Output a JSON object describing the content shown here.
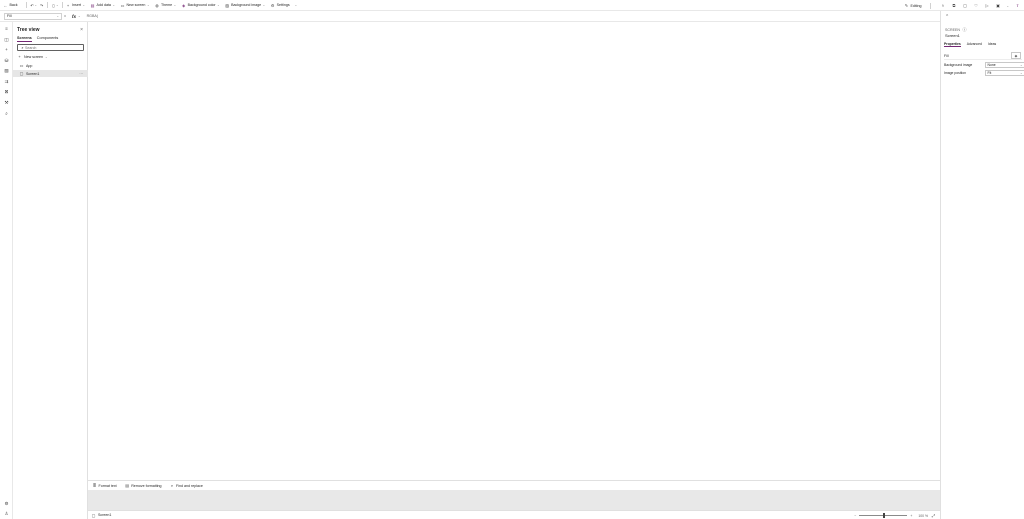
{
  "command_bar": {
    "back": "Back",
    "insert": "Insert",
    "add_data": "Add data",
    "new_screen": "New screen",
    "theme": "Theme",
    "background_color": "Background color",
    "background_image": "Background image",
    "settings": "Settings",
    "editing": "Editing"
  },
  "formula_bar": {
    "property": "Fill",
    "equals": "=",
    "fx": "fx",
    "value": "RGBA("
  },
  "tree_view": {
    "title": "Tree view",
    "tabs": [
      "Screens",
      "Components"
    ],
    "search_placeholder": "Search",
    "new_screen": "New screen",
    "items": [
      "App",
      "Screen1"
    ]
  },
  "bottom_toolbar": {
    "format_text": "Format text",
    "remove_formatting": "Remove formatting",
    "find_replace": "Find and replace"
  },
  "status_bar": {
    "screen": "Screen1",
    "zoom_minus": "−",
    "zoom_plus": "+",
    "zoom_value": "100 %",
    "zoom_level": 0.5
  },
  "properties_panel": {
    "kind": "SCREEN",
    "screen_name": "Screen1",
    "tabs": [
      "Properties",
      "Advanced",
      "Ideas"
    ],
    "fill_label": "Fill",
    "rows": [
      {
        "label": "Background image",
        "value": "None"
      },
      {
        "label": "Image position",
        "value": "Fit"
      }
    ]
  },
  "colors": {
    "accent": "#742774",
    "canvas_bg": "#ffffff",
    "gray_area": "#e8e8e8"
  }
}
